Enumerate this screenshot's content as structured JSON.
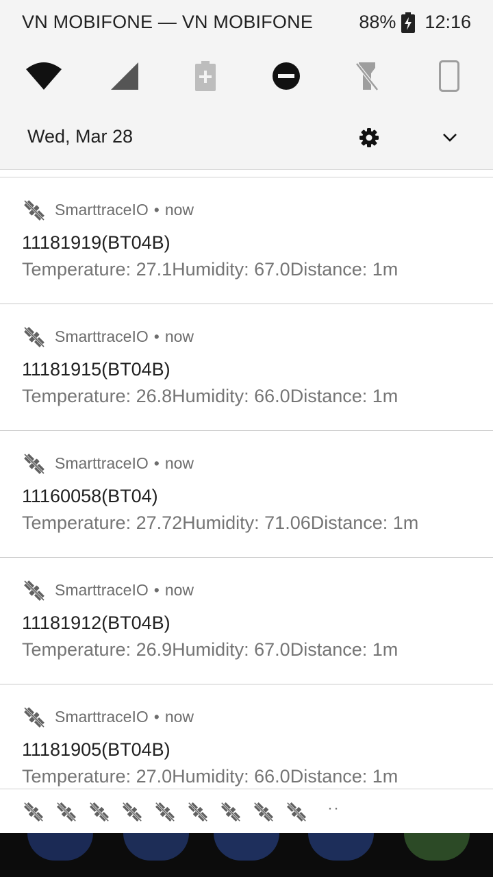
{
  "status_bar": {
    "carrier": "VN MOBIFONE — VN MOBIFONE",
    "battery_percent": "88%",
    "time": "12:16",
    "battery_level": 0.88
  },
  "quick_settings": {
    "tiles": [
      {
        "name": "wifi-icon"
      },
      {
        "name": "cellular-signal-icon"
      },
      {
        "name": "battery-saver-icon"
      },
      {
        "name": "do-not-disturb-icon"
      },
      {
        "name": "flashlight-off-icon"
      },
      {
        "name": "auto-rotate-icon"
      }
    ],
    "date": "Wed, Mar 28",
    "settings_icon": "gear-icon",
    "expand_icon": "chevron-down-icon"
  },
  "notifications": [
    {
      "app": "SmarttraceIO",
      "separator": "•",
      "time": "now",
      "title": "11181919(BT04B)",
      "text": "Temperature: 27.1Humidity: 67.0Distance: 1m"
    },
    {
      "app": "SmarttraceIO",
      "separator": "•",
      "time": "now",
      "title": "11181915(BT04B)",
      "text": "Temperature: 26.8Humidity: 66.0Distance: 1m"
    },
    {
      "app": "SmarttraceIO",
      "separator": "•",
      "time": "now",
      "title": "11160058(BT04)",
      "text": "Temperature: 27.72Humidity: 71.06Distance: 1m"
    },
    {
      "app": "SmarttraceIO",
      "separator": "•",
      "time": "now",
      "title": "11181912(BT04B)",
      "text": "Temperature: 26.9Humidity: 67.0Distance: 1m"
    },
    {
      "app": "SmarttraceIO",
      "separator": "•",
      "time": "now",
      "title": "11181905(BT04B)",
      "text": "Temperature: 27.0Humidity: 66.0Distance: 1m"
    }
  ],
  "overflow": {
    "icon_count": 9,
    "icon_name": "satellite-icon",
    "more_indicator": "··"
  },
  "colors": {
    "shade_bg": "#f4f4f4",
    "primary_text": "#212121",
    "secondary_text": "#757575",
    "icon_gray": "#616161"
  }
}
